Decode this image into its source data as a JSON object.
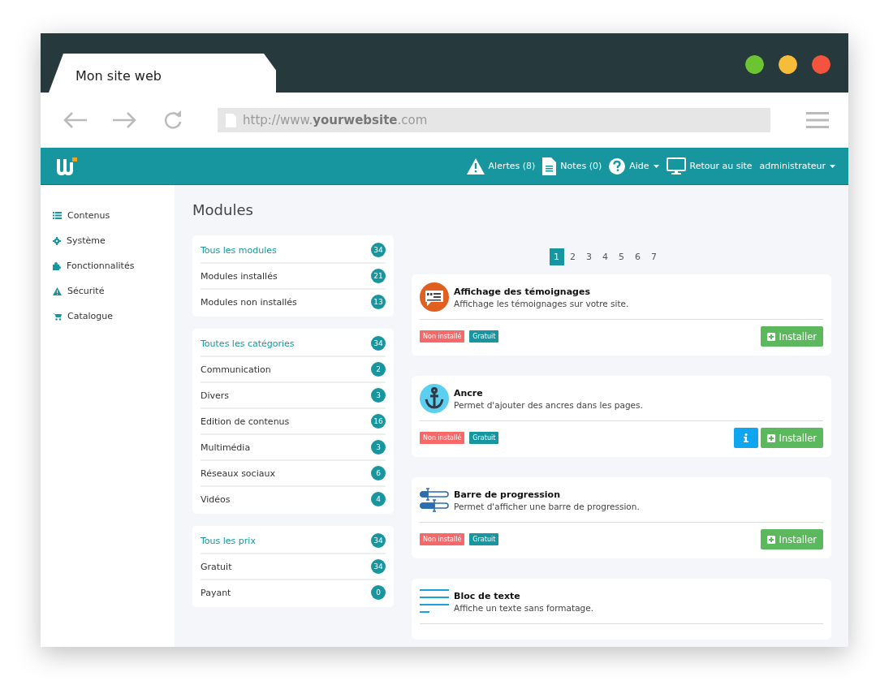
{
  "browser": {
    "tab_title": "Mon site web",
    "url": "http://www.**yourwebsite**.com"
  },
  "header": {
    "items": [
      {
        "kind": "alert",
        "label": "Alertes (8)"
      },
      {
        "kind": "notes",
        "label": "Notes (0)"
      },
      {
        "kind": "help",
        "label": "Aide",
        "dropdown": true
      },
      {
        "kind": "site",
        "label": "Retour au site"
      },
      {
        "kind": "user",
        "label": "administrateur",
        "dropdown": true
      }
    ]
  },
  "sidebar": {
    "items": [
      {
        "kind": "list",
        "label": "Contenus"
      },
      {
        "kind": "gear",
        "label": "Système"
      },
      {
        "kind": "puzzle",
        "label": "Fonctionnalités"
      },
      {
        "kind": "warning",
        "label": "Sécurité"
      },
      {
        "kind": "cart",
        "label": "Catalogue"
      }
    ]
  },
  "page_title": "Modules",
  "filters": [
    [
      {
        "label": "Tous les modules",
        "count": "34",
        "selected": true
      },
      {
        "label": "Modules installés",
        "count": "21",
        "selected": false
      },
      {
        "label": "Modules non installés",
        "count": "13",
        "selected": false
      }
    ],
    [
      {
        "label": "Toutes les catégories",
        "count": "34",
        "selected": true
      },
      {
        "label": "Communication",
        "count": "2",
        "selected": false
      },
      {
        "label": "Divers",
        "count": "3",
        "selected": false
      },
      {
        "label": "Edition de contenus",
        "count": "16",
        "selected": false
      },
      {
        "label": "Multimédia",
        "count": "3",
        "selected": false
      },
      {
        "label": "Réseaux sociaux",
        "count": "6",
        "selected": false
      },
      {
        "label": "Vidéos",
        "count": "4",
        "selected": false
      }
    ],
    [
      {
        "label": "Tous les prix",
        "count": "34",
        "selected": true
      },
      {
        "label": "Gratuit",
        "count": "34",
        "selected": false
      },
      {
        "label": "Payant",
        "count": "0",
        "selected": false
      }
    ]
  ],
  "pagination": [
    {
      "label": "1",
      "selected": true
    },
    {
      "label": "2",
      "selected": false
    },
    {
      "label": "3",
      "selected": false
    },
    {
      "label": "4",
      "selected": false
    },
    {
      "label": "5",
      "selected": false
    },
    {
      "label": "6",
      "selected": false
    },
    {
      "label": "7",
      "selected": false
    }
  ],
  "modules": [
    {
      "kind": "testimonial",
      "title": "Affichage des témoignages",
      "description": "Affichage les témoignages sur votre site.",
      "tags": [
        {
          "kind": "status",
          "label": "Non installé"
        },
        {
          "kind": "price",
          "label": "Gratuit"
        }
      ],
      "info": false,
      "action": "Installer"
    },
    {
      "kind": "anchor",
      "title": "Ancre",
      "description": "Permet d'ajouter des ancres dans les pages.",
      "tags": [
        {
          "kind": "status",
          "label": "Non installé"
        },
        {
          "kind": "price",
          "label": "Gratuit"
        }
      ],
      "info": true,
      "action": "Installer"
    },
    {
      "kind": "progress",
      "title": "Barre de progression",
      "description": "Permet d'afficher une barre de progression.",
      "tags": [
        {
          "kind": "status",
          "label": "Non installé"
        },
        {
          "kind": "price",
          "label": "Gratuit"
        }
      ],
      "info": false,
      "action": "Installer"
    },
    {
      "kind": "text",
      "title": "Bloc de texte",
      "description": "Affiche un texte sans formatage."
    }
  ]
}
